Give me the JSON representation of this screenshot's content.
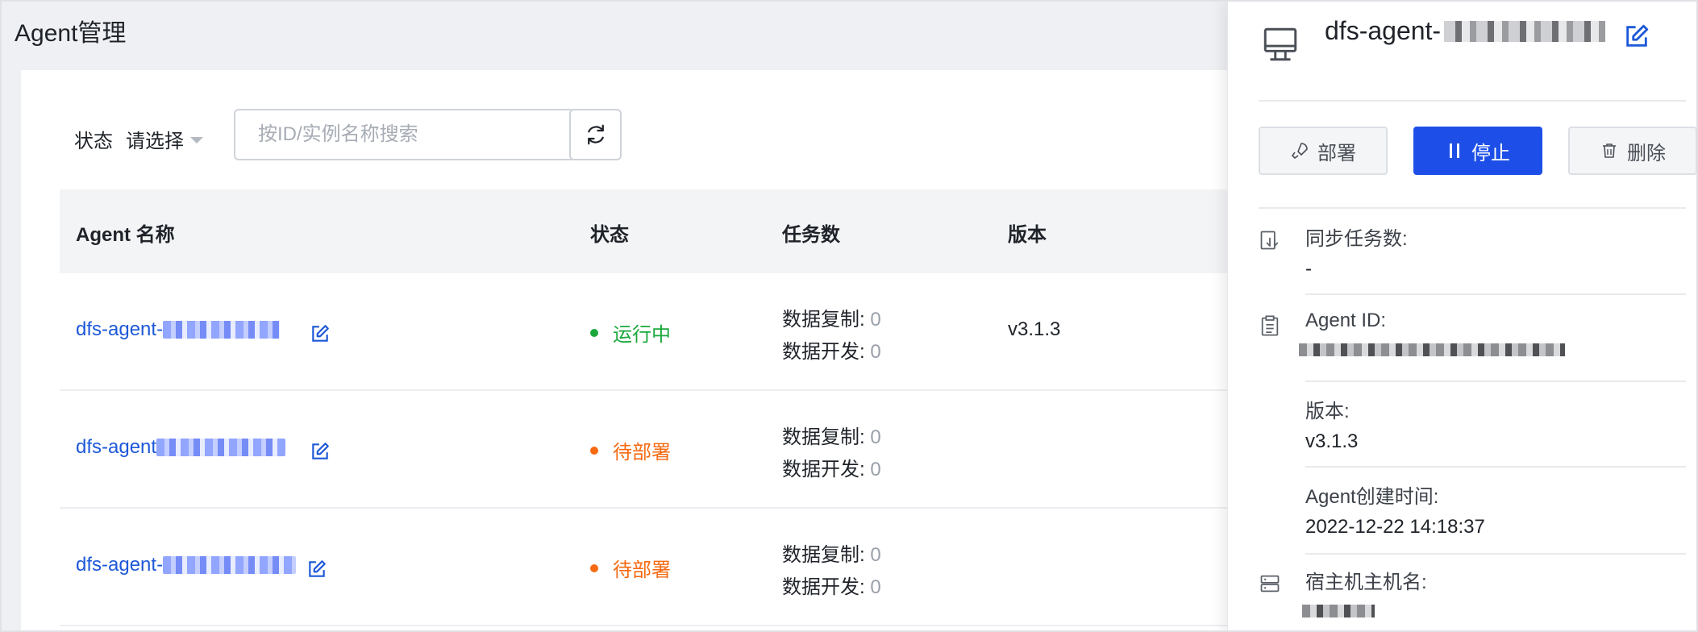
{
  "page": {
    "title": "Agent管理"
  },
  "filters": {
    "status_label": "状态",
    "status_select": "请选择",
    "search_placeholder": "按ID/实例名称搜索"
  },
  "table": {
    "columns": [
      "Agent 名称",
      "状态",
      "任务数",
      "版本"
    ],
    "rows": [
      {
        "name": "dfs-agent-",
        "status": "运行中",
        "status_color": "#1aa83b",
        "task_copy_label": "数据复制:",
        "task_copy": "0",
        "task_dev_label": "数据开发:",
        "task_dev": "0",
        "version": "v3.1.3"
      },
      {
        "name": "dfs-agent",
        "status": "待部署",
        "status_color": "#f56a12",
        "task_copy_label": "数据复制:",
        "task_copy": "0",
        "task_dev_label": "数据开发:",
        "task_dev": "0",
        "version": ""
      },
      {
        "name": "dfs-agent-",
        "status": "待部署",
        "status_color": "#f56a12",
        "task_copy_label": "数据复制:",
        "task_copy": "0",
        "task_dev_label": "数据开发:",
        "task_dev": "0",
        "version": ""
      }
    ]
  },
  "drawer": {
    "title": "dfs-agent-",
    "buttons": {
      "deploy": "部署",
      "stop": "停止",
      "delete": "删除"
    },
    "sync_tasks_label": "同步任务数:",
    "sync_tasks_value": "-",
    "agent_id_label": "Agent ID:",
    "version_label": "版本:",
    "version_value": "v3.1.3",
    "created_label": "Agent创建时间:",
    "created_value": "2022-12-22 14:18:37",
    "host_label": "宿主机主机名:"
  },
  "colors": {
    "link": "#1d58d8",
    "primary": "#1d4fe8",
    "running": "#1aa83b",
    "pending": "#f56a12"
  },
  "icons": [
    "refresh-icon",
    "edit-icon",
    "monitor-icon",
    "rocket-icon",
    "pause-icon",
    "trash-icon",
    "sync-icon",
    "clipboard-icon",
    "server-icon"
  ]
}
